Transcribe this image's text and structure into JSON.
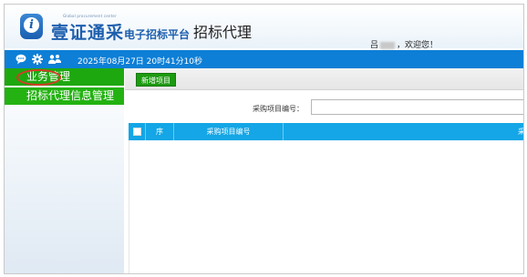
{
  "header": {
    "logo_text": "壹证通采",
    "logo_sub": "Global procurement center",
    "platform_name": "电子招标平台",
    "module_name": "招标代理",
    "user_name": "吕",
    "welcome": "，欢迎您！"
  },
  "statusbar": {
    "datetime": "2025年08月27日 20时41分10秒",
    "icons": [
      "chat-icon",
      "settings-icon",
      "users-icon"
    ]
  },
  "sidebar": {
    "group_label": "业务管理",
    "items": [
      {
        "label": "招标代理信息管理"
      }
    ]
  },
  "toolbar": {
    "add_label": "新增项目"
  },
  "search": {
    "label": "采购项目编号："
  },
  "grid": {
    "columns": [
      "序",
      "采购项目编号",
      "采"
    ]
  },
  "colors": {
    "brand_blue": "#1e5fae",
    "statusbar_blue": "#0d7fd6",
    "menu_green": "#1ea80f",
    "grid_header_blue": "#14a6e6",
    "highlight_ring": "#d43a2a"
  }
}
